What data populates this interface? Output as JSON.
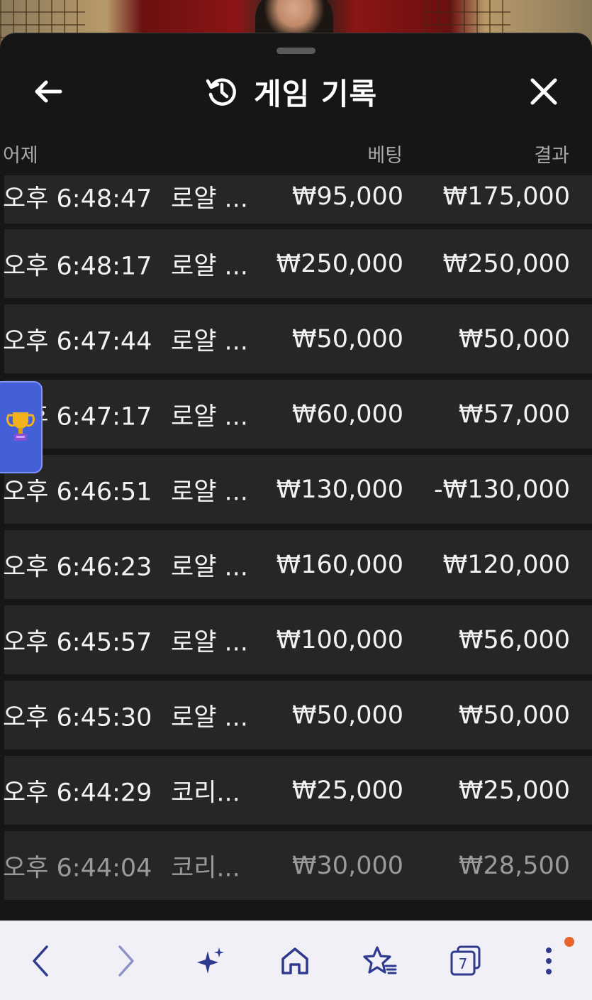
{
  "header": {
    "title": "게임 기록",
    "history_icon": "history-icon",
    "back_icon": "arrow-left-icon",
    "close_icon": "close-icon"
  },
  "columns": {
    "time": "어제",
    "bet": "베팅",
    "result": "결과"
  },
  "rows": [
    {
      "time": "오후 6:48:47",
      "game": "로얄 ...",
      "bet": "₩95,000",
      "result": "₩175,000"
    },
    {
      "time": "오후 6:48:17",
      "game": "로얄 ...",
      "bet": "₩250,000",
      "result": "₩250,000"
    },
    {
      "time": "오후 6:47:44",
      "game": "로얄 ...",
      "bet": "₩50,000",
      "result": "₩50,000"
    },
    {
      "time": "오후 6:47:17",
      "game": "로얄 ...",
      "bet": "₩60,000",
      "result": "₩57,000"
    },
    {
      "time": "오후 6:46:51",
      "game": "로얄 ...",
      "bet": "₩130,000",
      "result": "-₩130,000"
    },
    {
      "time": "오후 6:46:23",
      "game": "로얄 ...",
      "bet": "₩160,000",
      "result": "₩120,000"
    },
    {
      "time": "오후 6:45:57",
      "game": "로얄 ...",
      "bet": "₩100,000",
      "result": "₩56,000"
    },
    {
      "time": "오후 6:45:30",
      "game": "로얄 ...",
      "bet": "₩50,000",
      "result": "₩50,000"
    },
    {
      "time": "오후 6:44:29",
      "game": "코리...",
      "bet": "₩25,000",
      "result": "₩25,000"
    },
    {
      "time": "오후 6:44:04",
      "game": "코리...",
      "bet": "₩30,000",
      "result": "₩28,500"
    }
  ],
  "floating_tab": {
    "icon": "trophy-icon"
  },
  "browser_bar": {
    "tab_count": "7",
    "icons": [
      "back-icon",
      "forward-icon",
      "sparkle-icon",
      "home-icon",
      "bookmark-star-icon",
      "tabs-icon",
      "more-icon"
    ],
    "accent_color": "#2f3a8f",
    "notification_color": "#e8642c"
  }
}
